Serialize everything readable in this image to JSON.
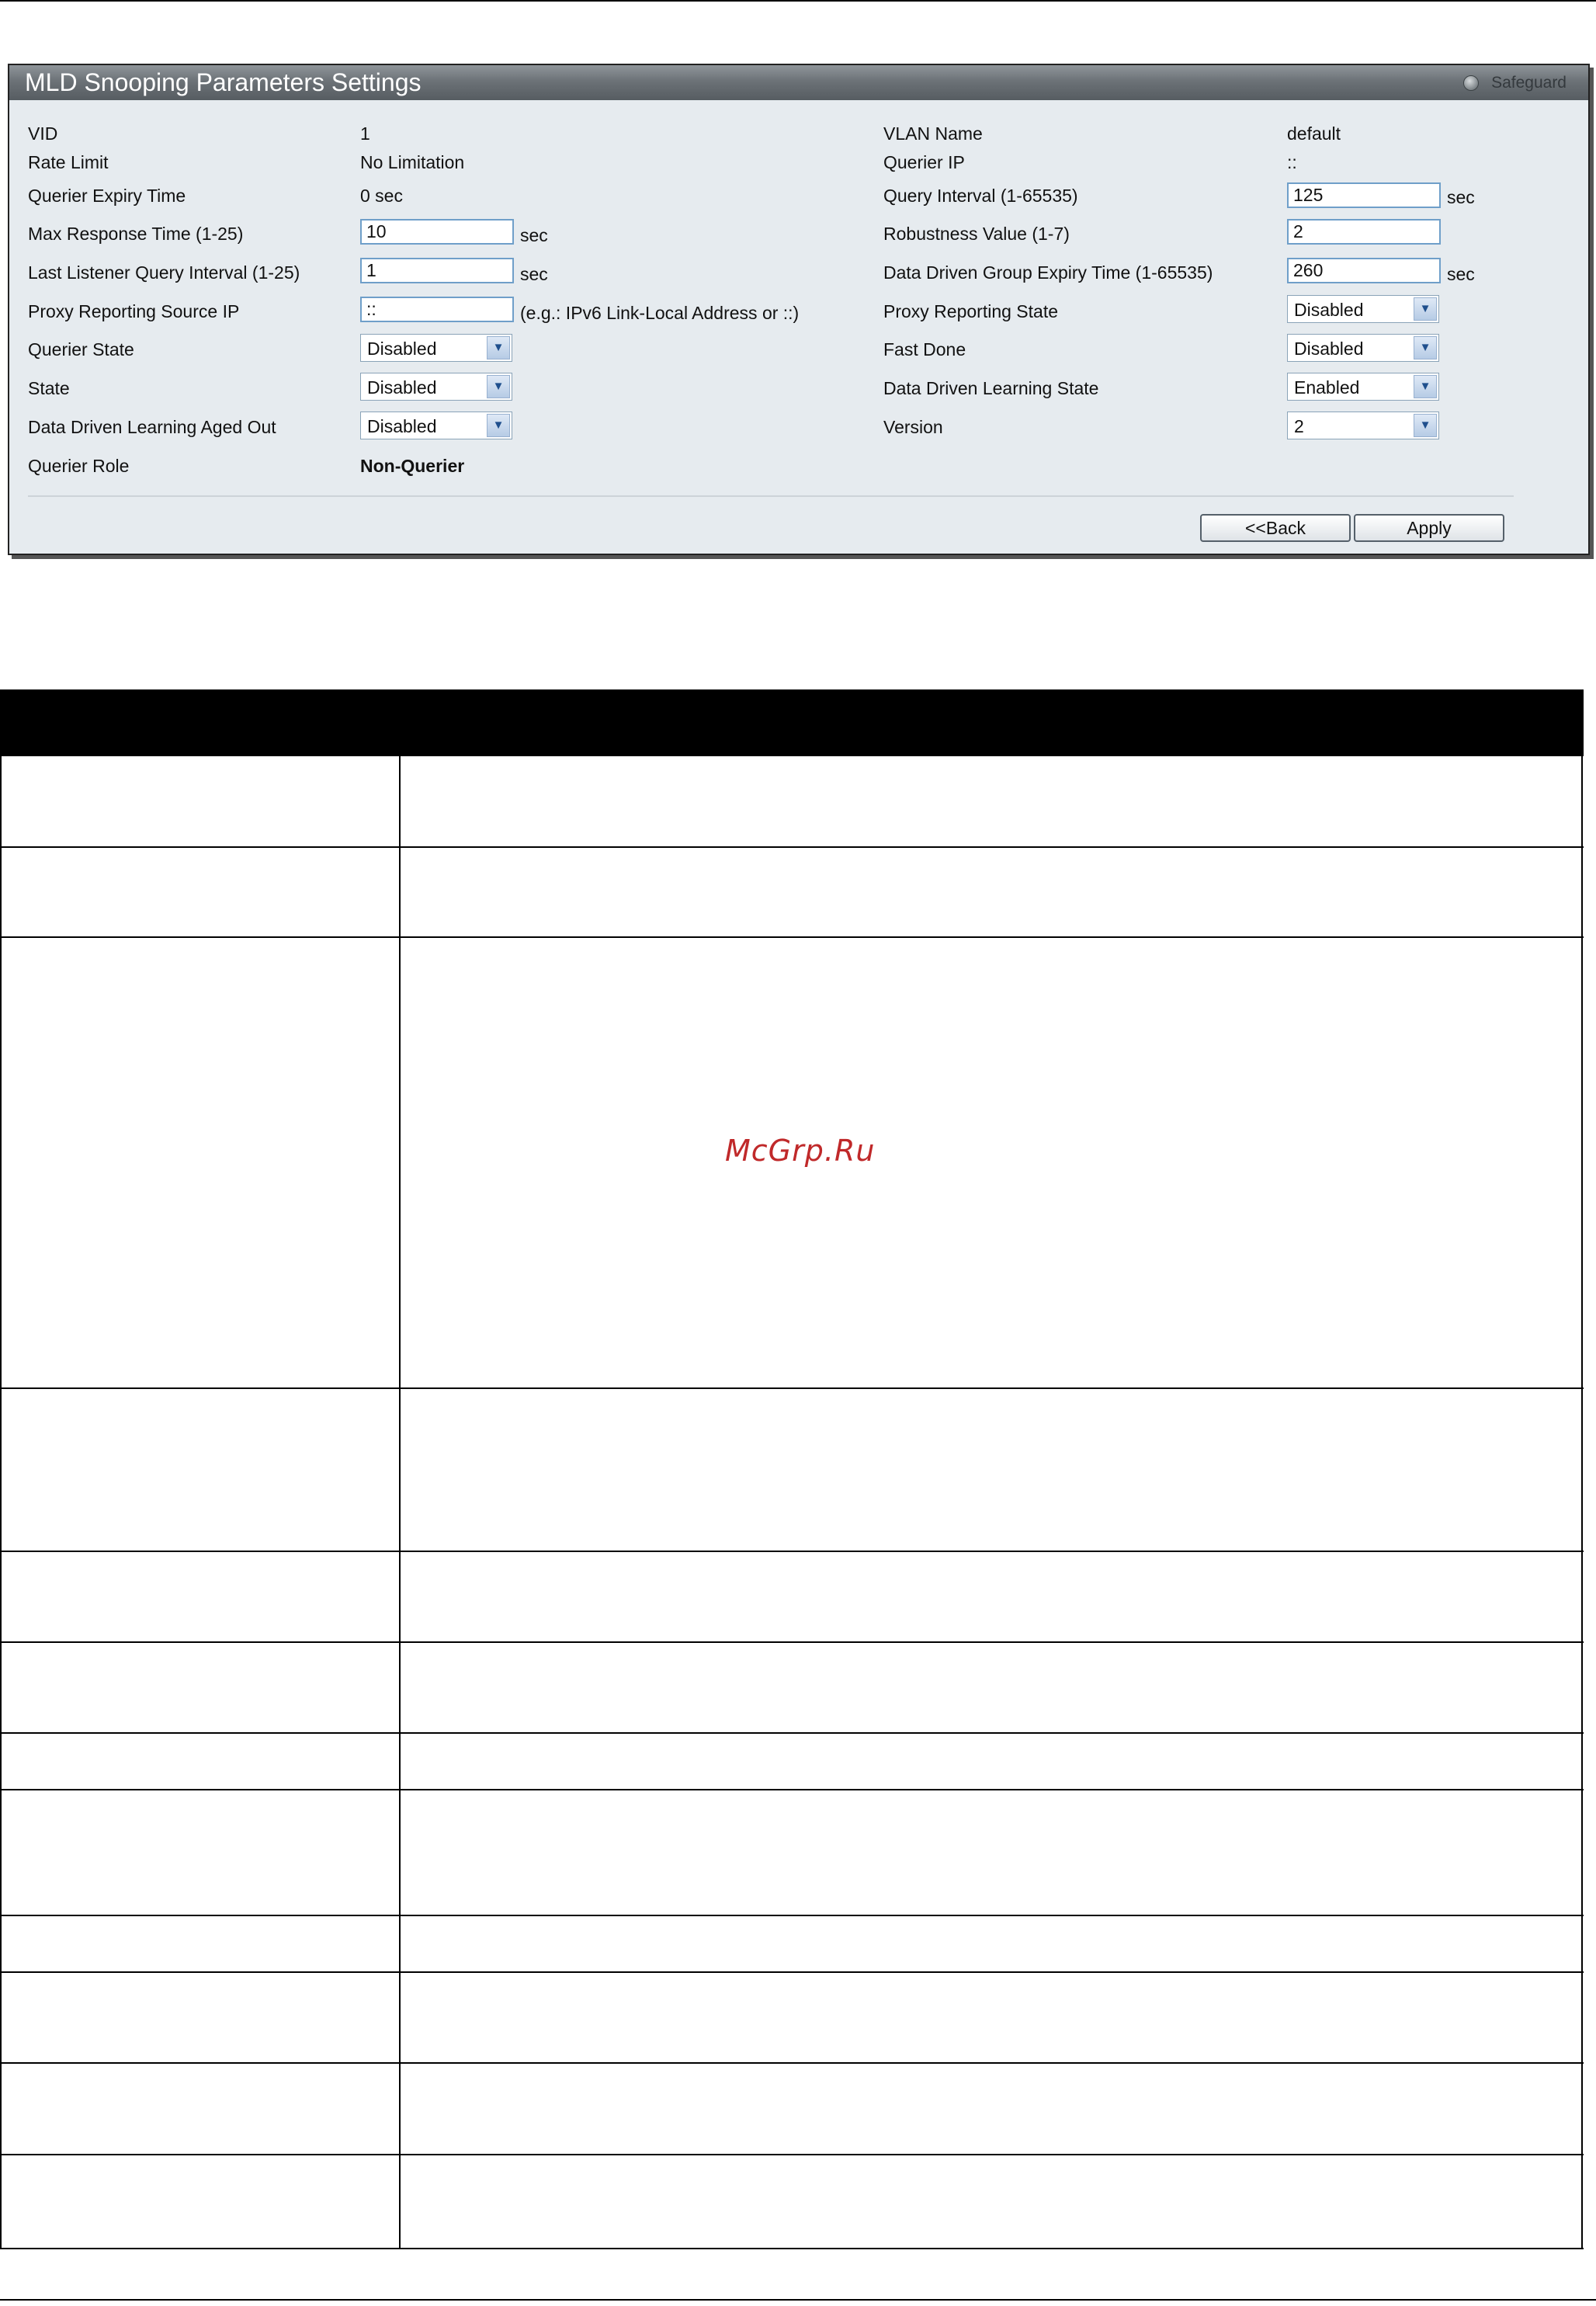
{
  "panel": {
    "title": "MLD Snooping Parameters Settings",
    "safeguard": "Safeguard"
  },
  "fields": {
    "vid": {
      "label": "VID",
      "value": "1"
    },
    "rate_limit": {
      "label": "Rate Limit",
      "value": "No Limitation"
    },
    "querier_expiry_time": {
      "label": "Querier Expiry Time",
      "value": "0 sec"
    },
    "max_response_time": {
      "label": "Max Response Time (1-25)",
      "value": "10",
      "unit": "sec"
    },
    "last_listener_query_interval": {
      "label": "Last Listener Query Interval (1-25)",
      "value": "1",
      "unit": "sec"
    },
    "proxy_reporting_source_ip": {
      "label": "Proxy Reporting Source IP",
      "value": "::",
      "hint": "(e.g.: IPv6 Link-Local Address or ::)"
    },
    "querier_state": {
      "label": "Querier State",
      "value": "Disabled"
    },
    "state": {
      "label": "State",
      "value": "Disabled"
    },
    "data_driven_learning_aged_out": {
      "label": "Data Driven Learning Aged Out",
      "value": "Disabled"
    },
    "querier_role": {
      "label": "Querier Role",
      "value": "Non-Querier"
    },
    "vlan_name": {
      "label": "VLAN Name",
      "value": "default"
    },
    "querier_ip": {
      "label": "Querier IP",
      "value": "::"
    },
    "query_interval": {
      "label": "Query Interval (1-65535)",
      "value": "125",
      "unit": "sec"
    },
    "robustness_value": {
      "label": "Robustness Value (1-7)",
      "value": "2"
    },
    "data_driven_group_expiry_time": {
      "label": "Data Driven Group Expiry Time (1-65535)",
      "value": "260",
      "unit": "sec"
    },
    "proxy_reporting_state": {
      "label": "Proxy Reporting State",
      "value": "Disabled"
    },
    "fast_done": {
      "label": "Fast Done",
      "value": "Disabled"
    },
    "data_driven_learning_state": {
      "label": "Data Driven Learning State",
      "value": "Enabled"
    },
    "version": {
      "label": "Version",
      "value": "2"
    }
  },
  "buttons": {
    "back": "<<Back",
    "apply": "Apply"
  },
  "watermark": "McGrp.Ru",
  "colors": {
    "titlebar": "#6c7277",
    "panel_bg": "#e6ebef",
    "input_border": "#6f9fc9",
    "watermark": "#c0292a"
  }
}
